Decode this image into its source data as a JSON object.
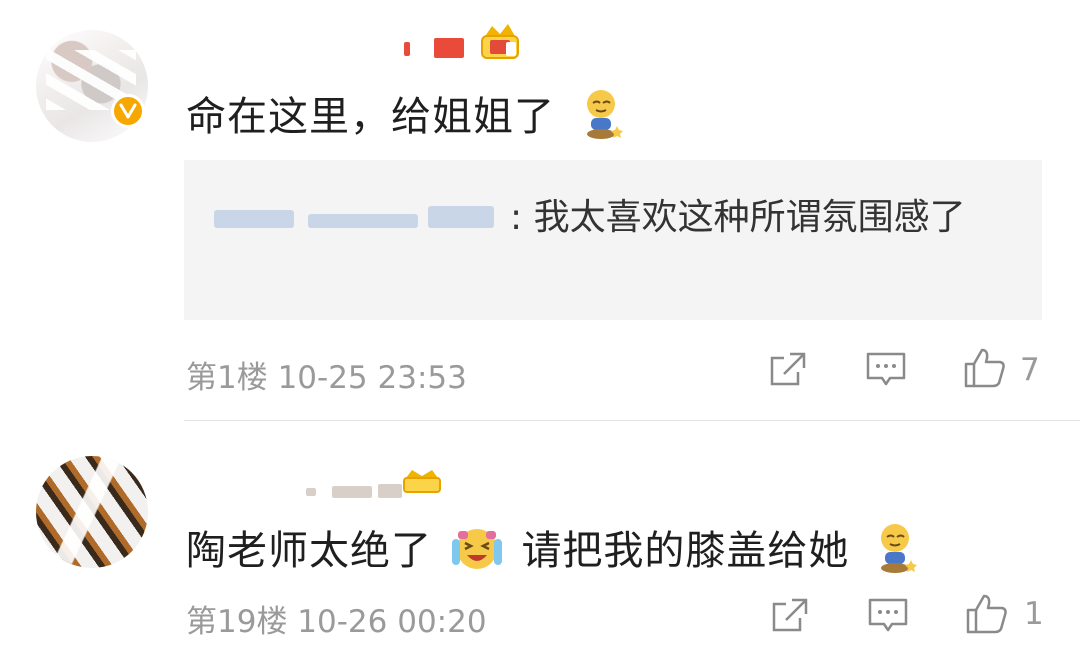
{
  "comments": [
    {
      "text": "命在这里，给姐姐了",
      "quote": {
        "text": ": 我太喜欢这种所谓氛围感了"
      },
      "meta": "第1楼 10-25 23:53",
      "likes": "7"
    },
    {
      "text_before": "陶老师太绝了",
      "text_after": "请把我的膝盖给她",
      "meta": "第19楼 10-26 00:20",
      "likes": "1"
    }
  ],
  "icons": {
    "share": "share-icon",
    "reply": "reply-icon",
    "like": "thumbs-up-icon",
    "verified": "verified-badge-icon",
    "crown": "crown-badge-icon",
    "kneel_emoji": "kneeling-emoji-icon",
    "laugh_emoji": "laughing-crying-emoji-icon"
  },
  "colors": {
    "accent_gold": "#f7a800",
    "meta_gray": "#9a9a9a",
    "quote_bg": "#f4f4f4"
  }
}
